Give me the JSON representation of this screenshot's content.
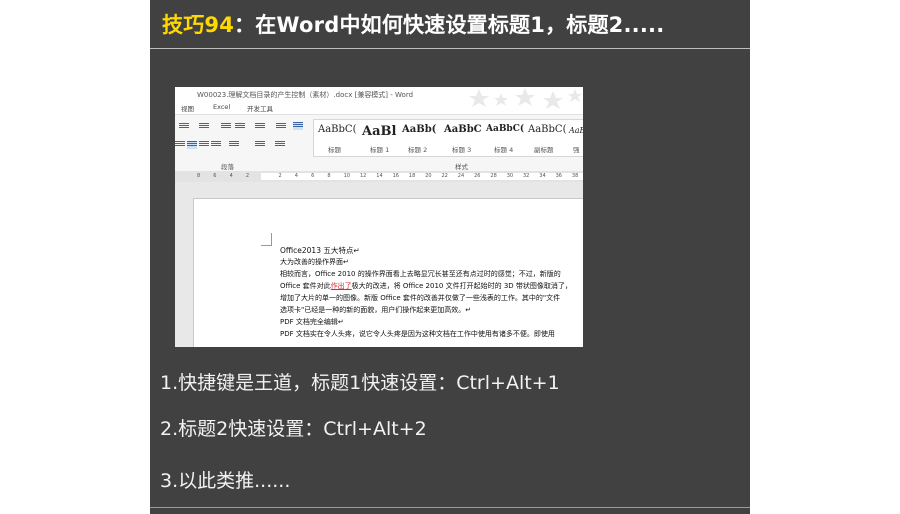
{
  "title": {
    "prefix": "技巧94",
    "text": "：在Word中如何快速设置标题1，标题2....."
  },
  "screenshot": {
    "window_title": "W00023.理解文档目录的产生控制（素材）.docx [兼容模式] - Word",
    "menu": [
      "视图",
      "Excel",
      "开发工具"
    ],
    "group_labels": [
      "段落",
      "样式"
    ],
    "styles": [
      {
        "sample": "AaBbC(",
        "name": "标题"
      },
      {
        "sample": "AaBl",
        "name": "标题 1"
      },
      {
        "sample": "AaBb(",
        "name": "标题 2"
      },
      {
        "sample": "AaBbC",
        "name": "标题 3"
      },
      {
        "sample": "AaBbC(",
        "name": "标题 4"
      },
      {
        "sample": "AaBbC(",
        "name": "副标题"
      },
      {
        "sample": "AaBb",
        "name": "强"
      }
    ],
    "ruler_numbers": [
      "8",
      "6",
      "4",
      "2",
      "",
      "2",
      "4",
      "6",
      "8",
      "10",
      "12",
      "14",
      "16",
      "18",
      "20",
      "22",
      "24",
      "26",
      "28",
      "30",
      "32",
      "34",
      "36",
      "38",
      "40"
    ],
    "doc_lines": [
      "Office2013 五大特点↵",
      "大为改善的操作界面↵",
      "相较而言，Office 2010 的操作界面看上去略显冗长甚至还有点过时的感觉；不过，新版的",
      "Office 套件对此作出了极大的改进，将 Office 2010 文件打开起始时的 3D 带状图像取消了，",
      "增加了大片的单一的图像。新版 Office 套件的改善并仅做了一些浅表的工作。其中的\"文件",
      "选项卡\"已经是一种的新的面貌，用户们操作起来更加高效。↵",
      "PDF 文档完全编辑↵",
      "PDF 文档实在令人头疼，说它令人头疼是因为这种文档在工作中使用有诸多不便。即使用"
    ],
    "underlined_fragment": "作出了"
  },
  "tips": [
    "1.快捷键是王道，标题1快速设置：Ctrl+Alt+1",
    "2.标题2快速设置：Ctrl+Alt+2",
    "3.以此类推......"
  ],
  "colors": {
    "panel": "#414141",
    "highlight": "#ffd800",
    "text": "#f2f2f2"
  }
}
